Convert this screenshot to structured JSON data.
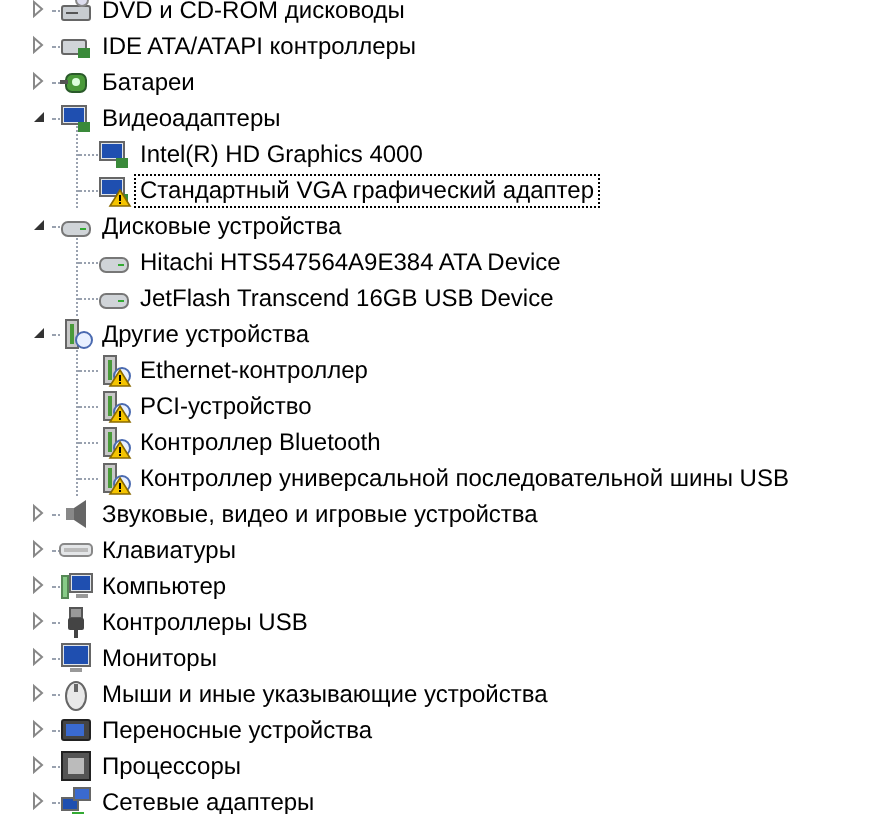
{
  "tree": [
    {
      "label": "DVD и CD-ROM дисководы",
      "kind": "drive",
      "expanded": false
    },
    {
      "label": "IDE ATA/ATAPI контроллеры",
      "kind": "controller",
      "expanded": false
    },
    {
      "label": "Батареи",
      "kind": "battery",
      "expanded": false
    },
    {
      "label": "Видеоадаптеры",
      "kind": "display",
      "expanded": true,
      "children": [
        {
          "label": "Intel(R) HD Graphics 4000",
          "kind": "display",
          "warning": false,
          "selected": false
        },
        {
          "label": "Стандартный VGA графический адаптер",
          "kind": "display",
          "warning": true,
          "selected": true
        }
      ]
    },
    {
      "label": "Дисковые устройства",
      "kind": "disk",
      "expanded": true,
      "children": [
        {
          "label": "Hitachi HTS547564A9E384 ATA Device",
          "kind": "disk",
          "warning": false,
          "selected": false
        },
        {
          "label": "JetFlash Transcend 16GB USB Device",
          "kind": "disk",
          "warning": false,
          "selected": false
        }
      ]
    },
    {
      "label": "Другие устройства",
      "kind": "unknown",
      "expanded": true,
      "children": [
        {
          "label": "Ethernet-контроллер",
          "kind": "unknown",
          "warning": true,
          "selected": false
        },
        {
          "label": "PCI-устройство",
          "kind": "unknown",
          "warning": true,
          "selected": false
        },
        {
          "label": "Контроллер Bluetooth",
          "kind": "unknown",
          "warning": true,
          "selected": false
        },
        {
          "label": "Контроллер универсальной последовательной шины USB",
          "kind": "unknown",
          "warning": true,
          "selected": false
        }
      ]
    },
    {
      "label": "Звуковые, видео и игровые устройства",
      "kind": "speaker",
      "expanded": false
    },
    {
      "label": "Клавиатуры",
      "kind": "keyboard",
      "expanded": false
    },
    {
      "label": "Компьютер",
      "kind": "computer",
      "expanded": false
    },
    {
      "label": "Контроллеры USB",
      "kind": "usb",
      "expanded": false
    },
    {
      "label": "Мониторы",
      "kind": "monitor",
      "expanded": false
    },
    {
      "label": "Мыши и иные указывающие устройства",
      "kind": "mouse",
      "expanded": false
    },
    {
      "label": "Переносные устройства",
      "kind": "portable",
      "expanded": false
    },
    {
      "label": "Процессоры",
      "kind": "cpu",
      "expanded": false
    },
    {
      "label": "Сетевые адаптеры",
      "kind": "network",
      "expanded": false
    }
  ]
}
